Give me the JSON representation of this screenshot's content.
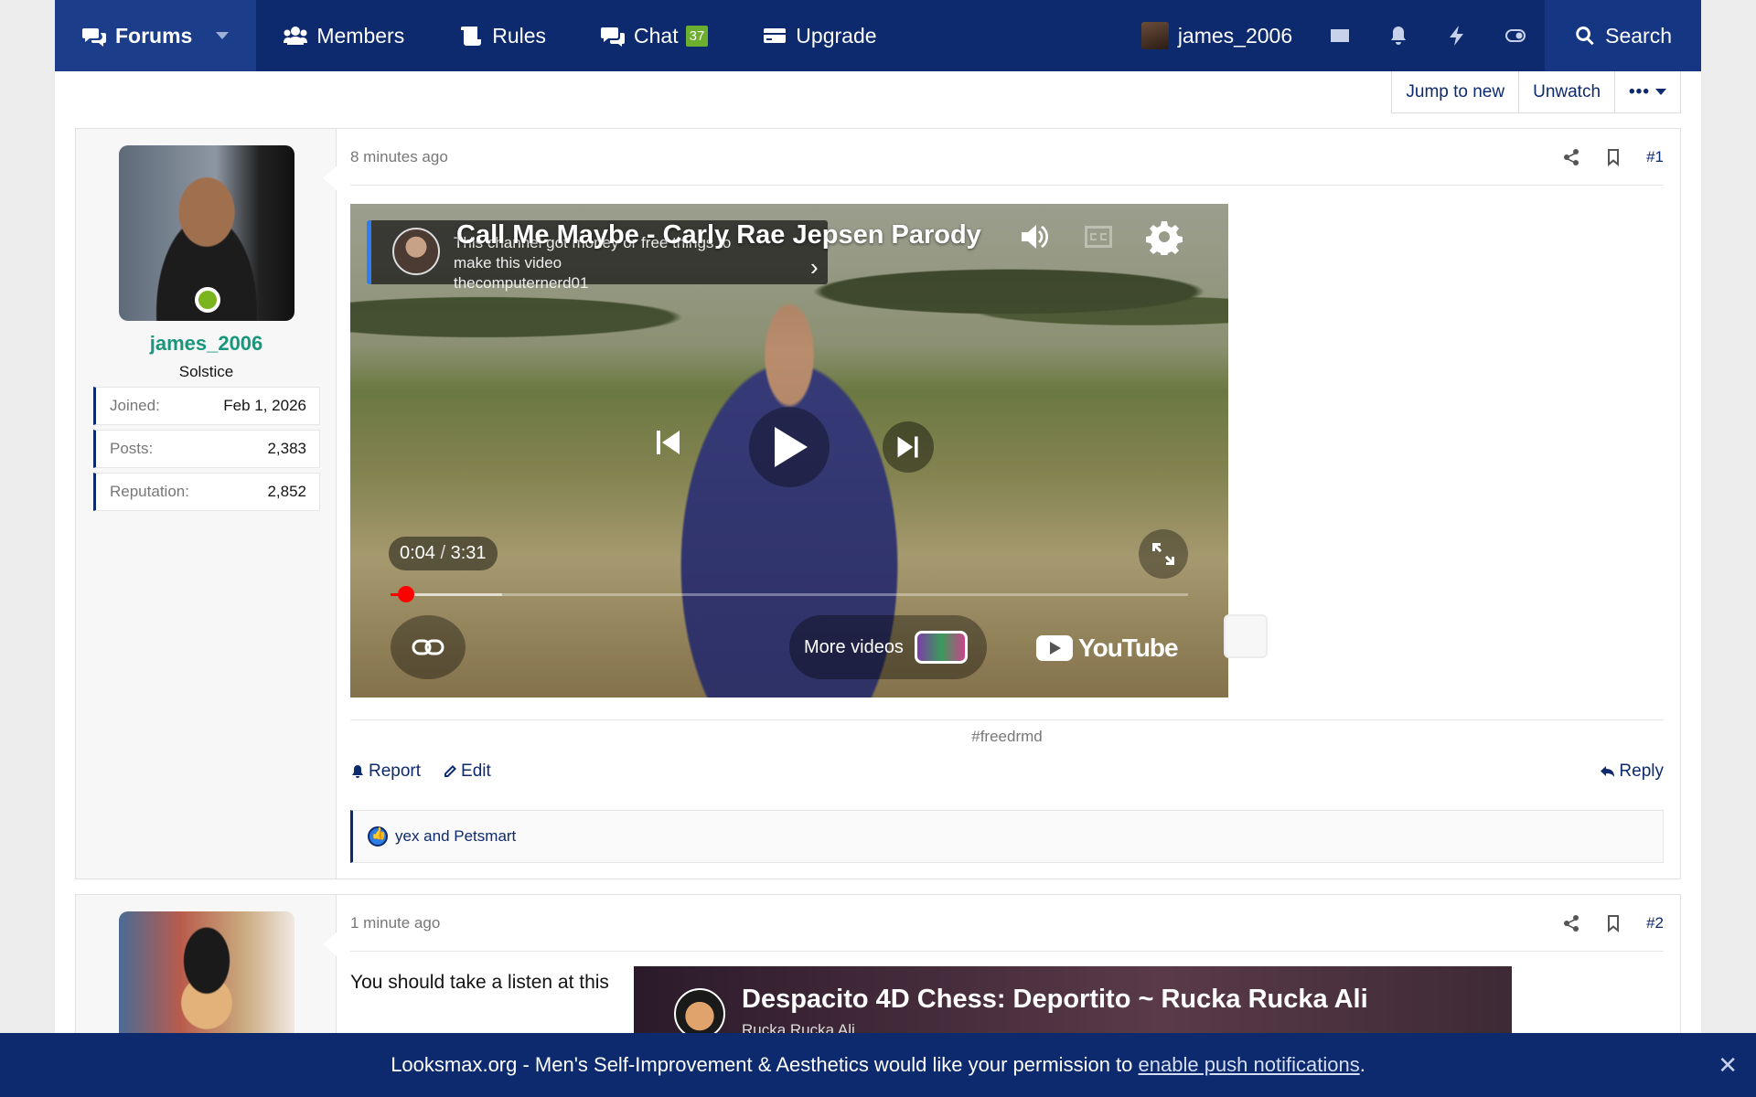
{
  "nav": {
    "items": [
      {
        "label": "Forums"
      },
      {
        "label": "Members"
      },
      {
        "label": "Rules"
      },
      {
        "label": "Chat",
        "badge": "37"
      },
      {
        "label": "Upgrade"
      }
    ],
    "username": "james_2006",
    "search_label": "Search"
  },
  "thread_toolbar": {
    "jump": "Jump to new",
    "unwatch": "Unwatch",
    "more": "•••"
  },
  "post1": {
    "user": {
      "name": "james_2006",
      "title": "Solstice",
      "stats": [
        {
          "key": "Joined:",
          "value": "Feb 1, 2026"
        },
        {
          "key": "Posts:",
          "value": "2,383"
        },
        {
          "key": "Reputation:",
          "value": "2,852"
        }
      ],
      "online": true
    },
    "time": "8 minutes ago",
    "number": "#1",
    "video": {
      "title": "Call Me Maybe - Carly Rae Jepsen Parody",
      "banner_line1": "This channel got money or free things to",
      "banner_line2": "make this video",
      "channel": "thecomputernerd01",
      "current_time": "0:04",
      "separator": "/",
      "duration": "3:31",
      "progress": 0.02,
      "buffered": 0.14,
      "more_videos": "More videos",
      "brand": "YouTube"
    },
    "signature": "#freedrmd",
    "actions": {
      "report": "Report",
      "edit": "Edit",
      "reply": "Reply"
    },
    "reactions_text": "yex and Petsmart"
  },
  "post2": {
    "time": "1 minute ago",
    "number": "#2",
    "text": "You should take a listen at this",
    "embed_title": "Despacito 4D Chess: Deportito ~ Rucka Rucka Ali",
    "embed_channel": "Rucka Rucka Ali"
  },
  "push": {
    "text": "Looksmax.org - Men's Self-Improvement & Aesthetics would like your permission to",
    "link": "enable push notifications",
    "end": ".",
    "close": "✕"
  }
}
